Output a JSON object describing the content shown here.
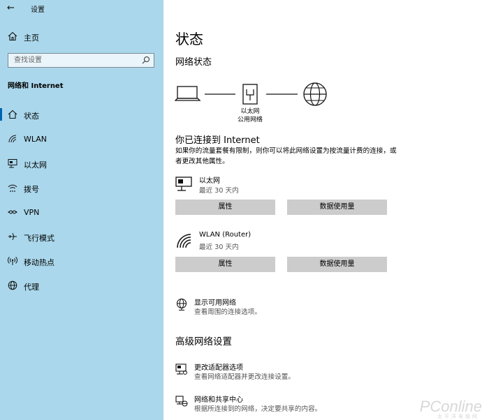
{
  "window": {
    "title": "设置"
  },
  "sidebar": {
    "home_label": "主页",
    "search_placeholder": "查找设置",
    "section_title": "网络和 Internet",
    "items": [
      {
        "label": "状态",
        "icon": "home-status-icon",
        "active": true
      },
      {
        "label": "WLAN",
        "icon": "wifi-icon"
      },
      {
        "label": "以太网",
        "icon": "ethernet-icon"
      },
      {
        "label": "拨号",
        "icon": "dialup-icon"
      },
      {
        "label": "VPN",
        "icon": "vpn-icon"
      },
      {
        "label": "飞行模式",
        "icon": "airplane-icon"
      },
      {
        "label": "移动热点",
        "icon": "hotspot-icon"
      },
      {
        "label": "代理",
        "icon": "globe-icon"
      }
    ]
  },
  "main": {
    "title": "状态",
    "network_status_title": "网络状态",
    "diagram_labels": [
      "以太网",
      "公用网络"
    ],
    "connected_title": "你已连接到 Internet",
    "description": "如果你的流量套餐有限制，则你可以将此网络设置为按流量计费的连接，或者更改其他属性。",
    "connections": [
      {
        "name": "以太网",
        "usage": "最近 30 天内",
        "icon": "ethernet-adapter-icon",
        "btn_props": "属性",
        "btn_usage": "数据使用量"
      },
      {
        "name": "WLAN (Router)",
        "usage": "最近 30 天内",
        "icon": "wifi-signal-icon",
        "btn_props": "属性",
        "btn_usage": "数据使用量"
      }
    ],
    "available": {
      "title": "显示可用网络",
      "desc": "查看周围的连接选项。"
    },
    "advanced_title": "高级网络设置",
    "advanced": [
      {
        "title": "更改适配器选项",
        "desc": "查看网络适配器并更改连接设置。"
      },
      {
        "title": "网络和共享中心",
        "desc": "根据所连接到的网络，决定要共享的内容。"
      }
    ]
  },
  "watermark": {
    "brand": "PConline",
    "sub": "太平洋电脑网"
  }
}
